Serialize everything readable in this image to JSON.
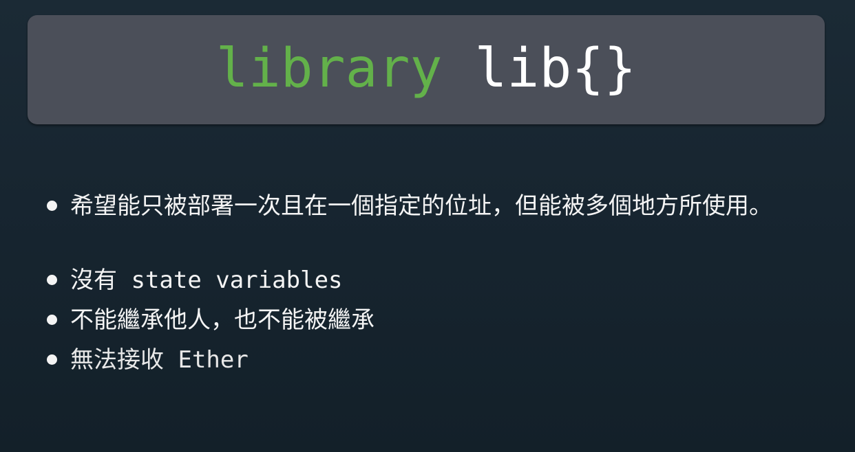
{
  "slide": {
    "title_keyword": "library",
    "title_name": " lib{}",
    "bullets": [
      {
        "text": "希望能只被部署一次且在一個指定的位址，但能被多個地方所使用。"
      },
      {
        "prefix": "沒有",
        "code": " state variables"
      },
      {
        "text": "不能繼承他人，也不能被繼承"
      },
      {
        "prefix": "無法接收",
        "code": " Ether"
      }
    ]
  },
  "colors": {
    "keyword": "#63b14a",
    "title_box": "#4b4f59",
    "background": "#172530"
  }
}
